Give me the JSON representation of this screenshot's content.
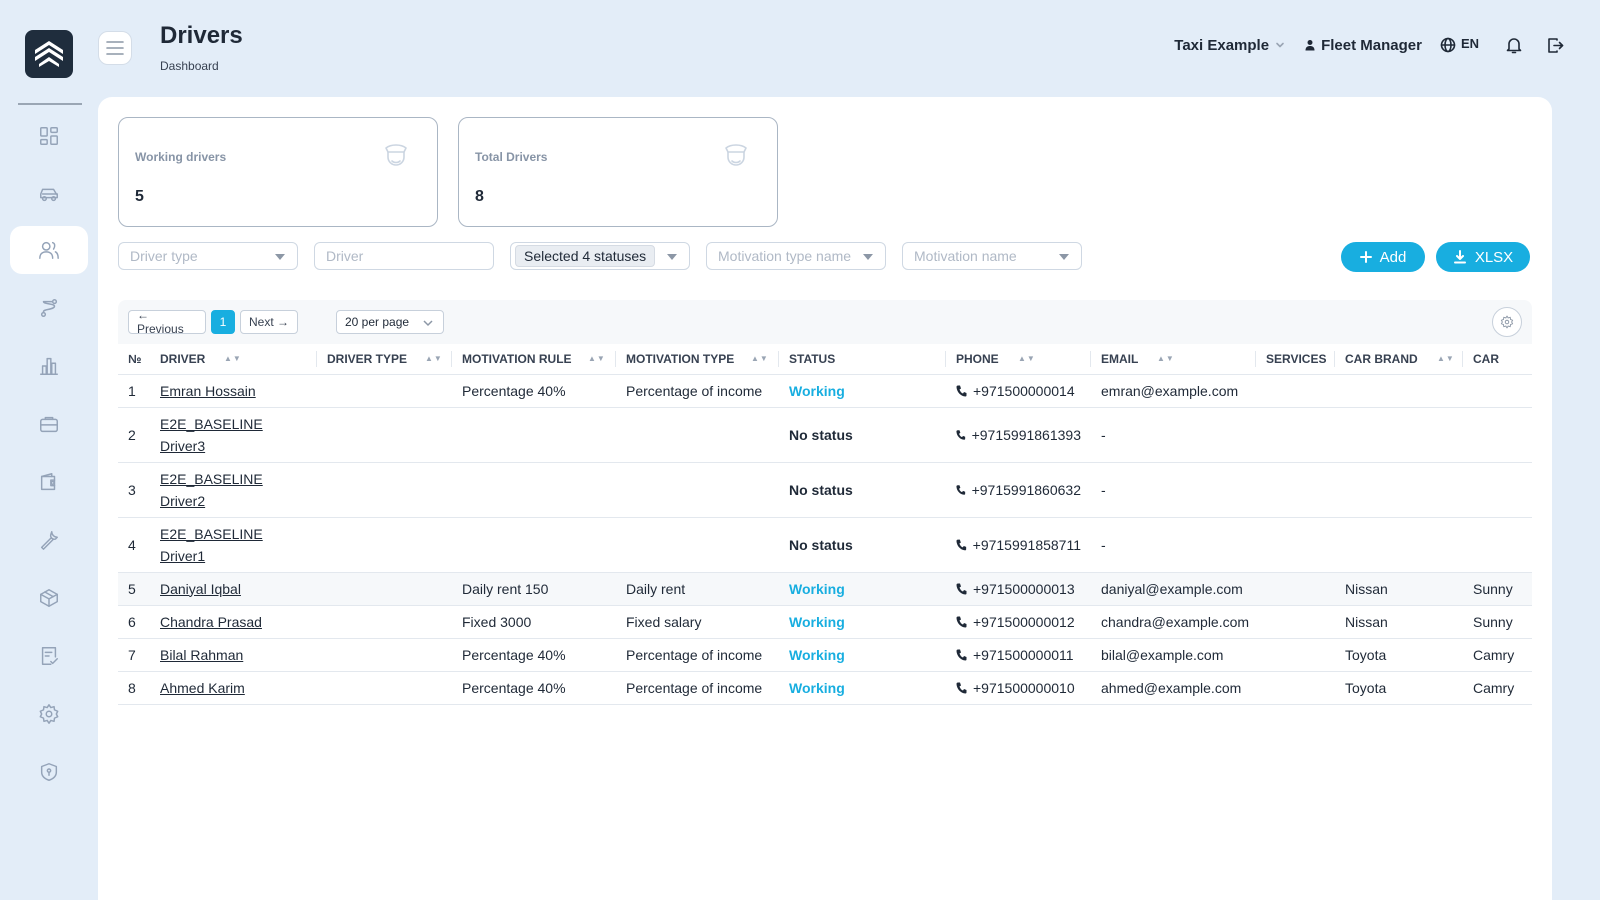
{
  "header": {
    "title": "Drivers",
    "subtitle": "Dashboard",
    "company": "Taxi Example",
    "user": "Fleet Manager",
    "language": "EN"
  },
  "sidebar": {
    "items": [
      {
        "icon": "dashboard-icon"
      },
      {
        "icon": "car-icon"
      },
      {
        "icon": "users-icon",
        "active": true
      },
      {
        "icon": "route-icon"
      },
      {
        "icon": "chart-icon"
      },
      {
        "icon": "briefcase-icon"
      },
      {
        "icon": "wallet-icon"
      },
      {
        "icon": "wrench-icon"
      },
      {
        "icon": "package-icon"
      },
      {
        "icon": "checklist-icon"
      },
      {
        "icon": "gear-icon"
      },
      {
        "icon": "shield-icon"
      }
    ]
  },
  "stats": {
    "working": {
      "label": "Working drivers",
      "value": "5"
    },
    "total": {
      "label": "Total Drivers",
      "value": "8"
    }
  },
  "filters": {
    "driver_type": "Driver type",
    "driver": "Driver",
    "statuses": "Selected 4 statuses",
    "motivation_type": "Motivation type name",
    "motivation_name": "Motivation name",
    "add_label": "Add",
    "xlsx_label": "XLSX"
  },
  "pagination": {
    "previous": "← Previous",
    "current": "1",
    "next": "Next →",
    "per_page": "20 per page"
  },
  "table": {
    "columns": [
      "№",
      "DRIVER",
      "DRIVER TYPE",
      "MOTIVATION RULE",
      "MOTIVATION TYPE",
      "STATUS",
      "PHONE",
      "EMAIL",
      "SERVICES",
      "CAR BRAND",
      "CAR"
    ],
    "rows": [
      {
        "n": "1",
        "driver": "Emran Hossain",
        "rule": "Percentage 40%",
        "mtype": "Percentage of income",
        "status": "Working",
        "phone": "+971500000014",
        "email": "emran@example.com",
        "brand": "",
        "car": ""
      },
      {
        "n": "2",
        "driver": "E2E_BASELINE Driver3",
        "rule": "",
        "mtype": "",
        "status": "No status",
        "phone": "+9715991861393",
        "email": "-",
        "brand": "",
        "car": ""
      },
      {
        "n": "3",
        "driver": "E2E_BASELINE Driver2",
        "rule": "",
        "mtype": "",
        "status": "No status",
        "phone": "+9715991860632",
        "email": "-",
        "brand": "",
        "car": ""
      },
      {
        "n": "4",
        "driver": "E2E_BASELINE Driver1",
        "rule": "",
        "mtype": "",
        "status": "No status",
        "phone": "+9715991858711",
        "email": "-",
        "brand": "",
        "car": ""
      },
      {
        "n": "5",
        "driver": "Daniyal Iqbal",
        "rule": "Daily rent 150",
        "mtype": "Daily rent",
        "status": "Working",
        "phone": "+971500000013",
        "email": "daniyal@example.com",
        "brand": "Nissan",
        "car": "Sunny"
      },
      {
        "n": "6",
        "driver": "Chandra Prasad",
        "rule": "Fixed 3000",
        "mtype": "Fixed salary",
        "status": "Working",
        "phone": "+971500000012",
        "email": "chandra@example.com",
        "brand": "Nissan",
        "car": "Sunny"
      },
      {
        "n": "7",
        "driver": "Bilal Rahman",
        "rule": "Percentage 40%",
        "mtype": "Percentage of income",
        "status": "Working",
        "phone": "+971500000011",
        "email": "bilal@example.com",
        "brand": "Toyota",
        "car": "Camry"
      },
      {
        "n": "8",
        "driver": "Ahmed Karim",
        "rule": "Percentage 40%",
        "mtype": "Percentage of income",
        "status": "Working",
        "phone": "+971500000010",
        "email": "ahmed@example.com",
        "brand": "Toyota",
        "car": "Camry"
      }
    ]
  },
  "colors": {
    "accent": "#18aee0",
    "background": "#e3edf8",
    "logo": "#1f2d3d"
  }
}
